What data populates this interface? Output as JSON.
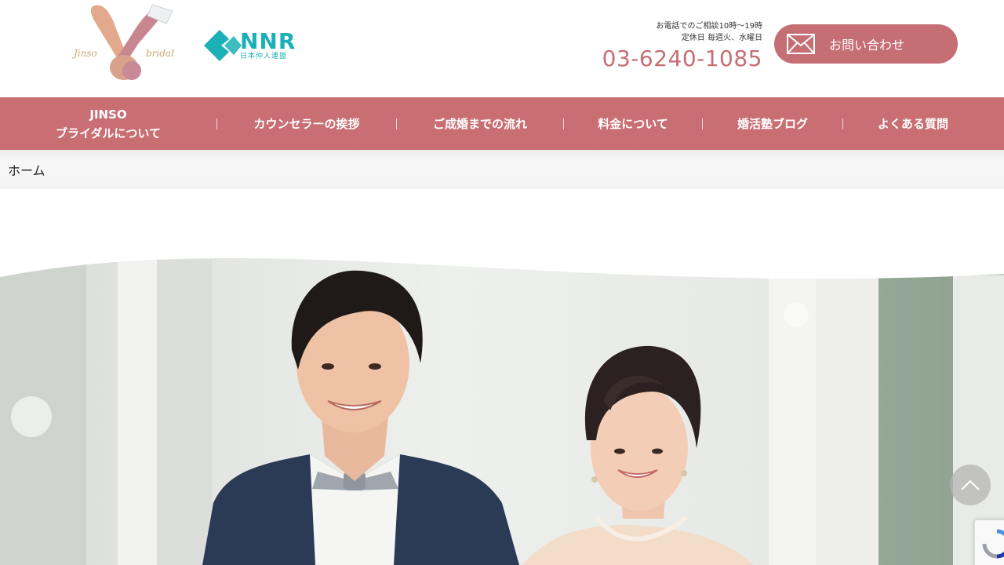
{
  "header": {
    "logo_jinso_alt": "Jinso bridal",
    "logo_nnr": {
      "letters": "NNR",
      "sub": "日本仲人連盟"
    },
    "hours_line1": "お電話でのご相談10時〜19時",
    "hours_line2": "定休日 毎週火、水曜日",
    "phone": "03-6240-1085",
    "inquiry_label": "お問い合わせ"
  },
  "nav": {
    "items": [
      {
        "line1": "JINSO",
        "line2": "ブライダルについて"
      },
      {
        "label": "カウンセラーの挨拶"
      },
      {
        "label": "ご成婚までの流れ"
      },
      {
        "label": "料金について"
      },
      {
        "label": "婚活塾ブログ"
      },
      {
        "label": "よくある質問"
      }
    ]
  },
  "breadcrumb": {
    "home": "ホーム"
  },
  "icons": {
    "mail": "mail-icon",
    "to_top": "chevron-up-icon",
    "recaptcha": "recaptcha-icon"
  },
  "colors": {
    "accent": "#c96e72",
    "nnr": "#1ab0b5",
    "phone": "#c56e73"
  }
}
